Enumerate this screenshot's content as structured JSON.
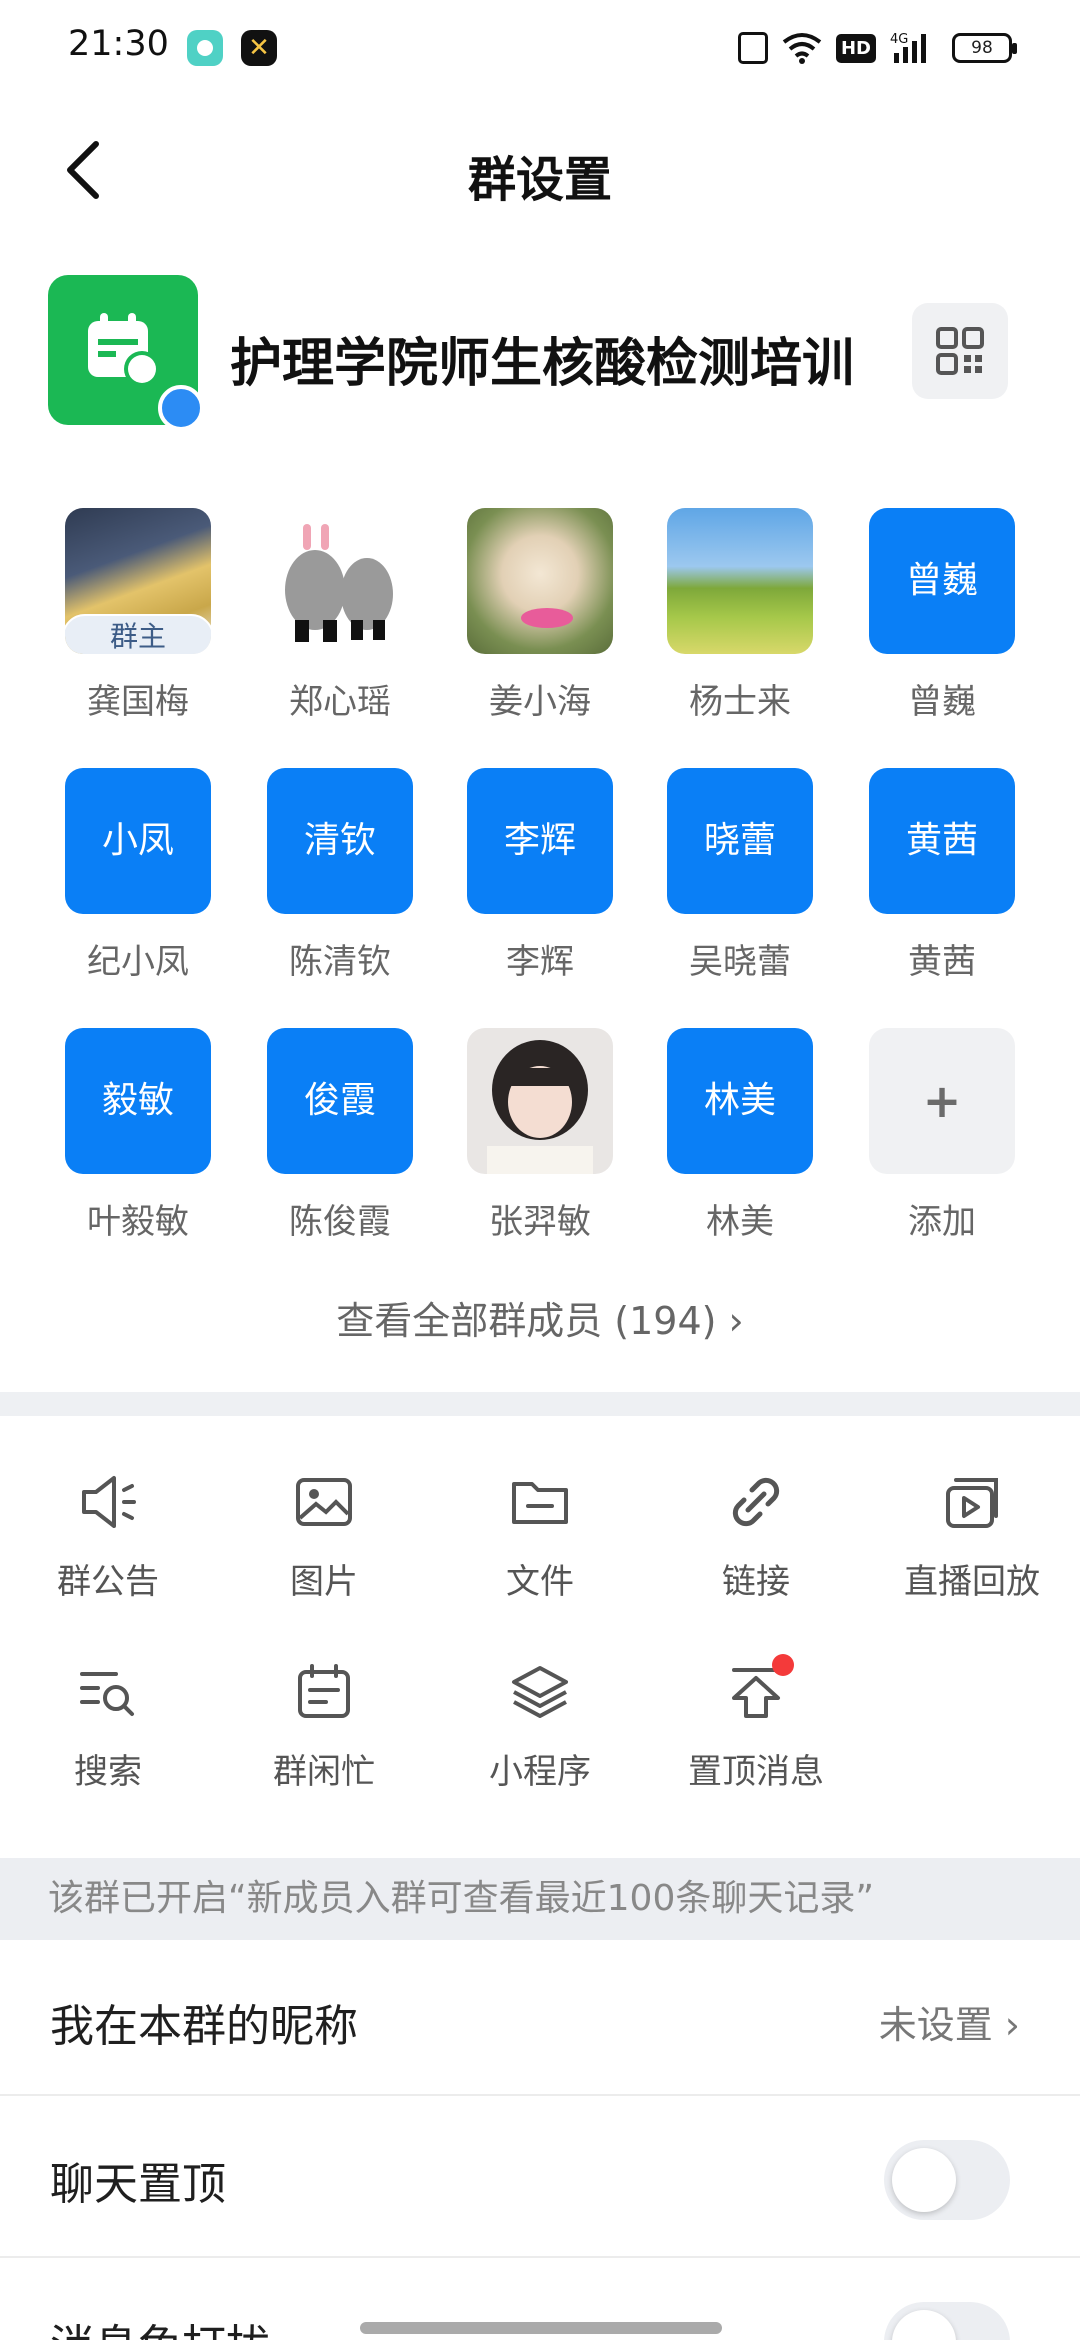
{
  "status_bar": {
    "time": "21:30",
    "battery": "98",
    "network": "4G",
    "hd": "HD"
  },
  "header": {
    "title": "群设置"
  },
  "group": {
    "name": "护理学院师生核酸检测培训"
  },
  "owner_tag": "群主",
  "members": [
    {
      "name": "龚国梅",
      "avatar_text": "",
      "photo": true
    },
    {
      "name": "郑心瑶",
      "avatar_text": "",
      "photo": true
    },
    {
      "name": "姜小海",
      "avatar_text": "",
      "photo": true
    },
    {
      "name": "杨士来",
      "avatar_text": "",
      "photo": true
    },
    {
      "name": "曾巍",
      "avatar_text": "曾巍"
    },
    {
      "name": "纪小凤",
      "avatar_text": "小凤"
    },
    {
      "name": "陈清钦",
      "avatar_text": "清钦"
    },
    {
      "name": "李辉",
      "avatar_text": "李辉"
    },
    {
      "name": "吴晓蕾",
      "avatar_text": "晓蕾"
    },
    {
      "name": "黄茜",
      "avatar_text": "黄茜"
    },
    {
      "name": "叶毅敏",
      "avatar_text": "毅敏"
    },
    {
      "name": "陈俊霞",
      "avatar_text": "俊霞"
    },
    {
      "name": "张羿敏",
      "avatar_text": "",
      "photo": true
    },
    {
      "name": "林美",
      "avatar_text": "林美"
    },
    {
      "name": "添加",
      "avatar_text": "+"
    }
  ],
  "view_all": "查看全部群成员 (194) ›",
  "functions": [
    {
      "label": "群公告",
      "icon": "megaphone-icon"
    },
    {
      "label": "图片",
      "icon": "image-icon"
    },
    {
      "label": "文件",
      "icon": "folder-icon"
    },
    {
      "label": "链接",
      "icon": "link-icon"
    },
    {
      "label": "直播回放",
      "icon": "replay-icon"
    },
    {
      "label": "搜索",
      "icon": "search-list-icon"
    },
    {
      "label": "群闲忙",
      "icon": "calendar-icon"
    },
    {
      "label": "小程序",
      "icon": "layers-icon"
    },
    {
      "label": "置顶消息",
      "icon": "pin-top-icon"
    }
  ],
  "notice": "该群已开启“新成员入群可查看最近100条聊天记录”",
  "settings": {
    "nickname_label": "我在本群的昵称",
    "nickname_value": "未设置 ›",
    "pin_label": "聊天置顶",
    "dnd_label": "消息免打扰"
  },
  "colors": {
    "accent_blue": "#0a7ff6",
    "group_green": "#1bb854",
    "badge_red": "#f43a3a"
  }
}
